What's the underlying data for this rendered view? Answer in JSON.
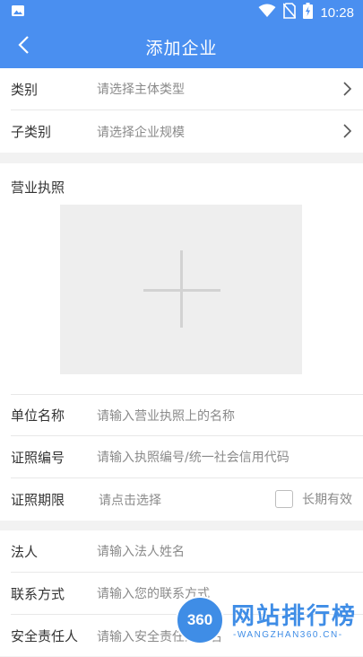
{
  "status_bar": {
    "time": "10:28",
    "icons": [
      "image-icon",
      "wifi-icon",
      "no-sim-icon",
      "battery-charging-icon"
    ]
  },
  "header": {
    "title": "添加企业",
    "back_icon": "back-arrow-icon"
  },
  "type_section": {
    "category": {
      "label": "类别",
      "placeholder": "请选择主体类型"
    },
    "subcategory": {
      "label": "子类别",
      "placeholder": "请选择企业规模"
    }
  },
  "license_section": {
    "title": "营业执照",
    "upload_icon": "add-photo-icon",
    "unit_name": {
      "label": "单位名称",
      "placeholder": "请输入营业执照上的名称"
    },
    "license_number": {
      "label": "证照编号",
      "placeholder": "请输入执照编号/统一社会信用代码"
    },
    "license_period": {
      "label": "证照期限",
      "placeholder": "请点击选择",
      "long_term_label": "长期有效",
      "long_term_checked": false
    }
  },
  "contact_section": {
    "legal_person": {
      "label": "法人",
      "placeholder": "请输入法人姓名"
    },
    "contact": {
      "label": "联系方式",
      "placeholder": "请输入您的联系方式"
    },
    "safety_officer": {
      "label": "安全责任人",
      "placeholder": "请输入安全责任人姓名"
    }
  },
  "watermark": {
    "logo_text": "360",
    "name": "网站排行榜",
    "url": "-WANGZHAN360.CN-"
  },
  "colors": {
    "primary": "#4a8ff0",
    "background": "#f2f2f2",
    "watermark": "#3f8de6"
  }
}
